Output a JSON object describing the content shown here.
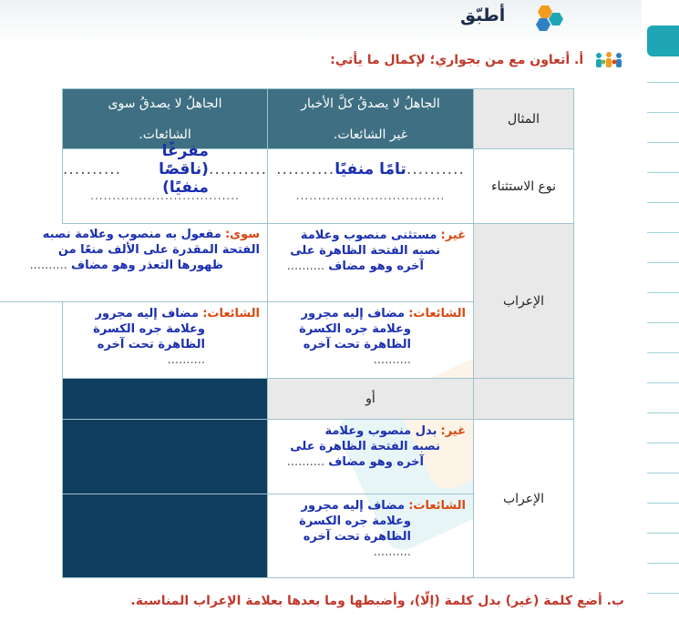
{
  "header": {
    "title": "أطبّق"
  },
  "instruction": "أ. أتعاون مع من بجواري؛ لإكمال ما يأتي:",
  "table": {
    "row_labels": {
      "example": "المثال",
      "type": "نوع الاستثناء",
      "parsing": "الإعراب",
      "or": "أو",
      "parsing2": "الإعراب"
    },
    "example_col1_line1": "الجاهلُ لا يصدقُ كلَّ الأخبار",
    "example_col1_line2": "غير الشائعات.",
    "example_col2_line1": "الجاهلُ لا يصدقُ سوى",
    "example_col2_line2": "الشائعات.",
    "type_col1": "تامًا منفيًا",
    "type_col2": "مفرغًا (ناقصًا منفيًا)",
    "dots_short": "..........",
    "dots_long": "..................................",
    "ghayr_label": "غير:",
    "sewa_label": "سوى:",
    "shaaat_label": "الشائعات:",
    "ghayr_parse_1": "مستثنى منصوب وعلامة",
    "ghayr_parse_2": "نصبه الفتحة الظاهرة على",
    "ghayr_parse_3": "آخره وهو مضاف",
    "sewa_parse_1": "مفعول به منصوب وعلامة نصبه",
    "sewa_parse_2": "الفتحة المقدرة على الألف منعًا من",
    "sewa_parse_3": "ظهورها التعذر وهو مضاف",
    "shaaat_parse_1": "مضاف إليه مجرور",
    "shaaat_parse_2": "وعلامة جره الكسرة",
    "shaaat_parse_3": "الظاهرة تحت آخره",
    "badal_parse_1": "بدل منصوب وعلامة",
    "badal_parse_2": "نصبه الفتحة الظاهرة على",
    "badal_parse_3": "آخره وهو مضاف"
  },
  "footer": "ب. أضع كلمة (غير) بدل كلمة (إلّا)، وأضبطها وما بعدها بعلامة الإعراب المناسبة."
}
